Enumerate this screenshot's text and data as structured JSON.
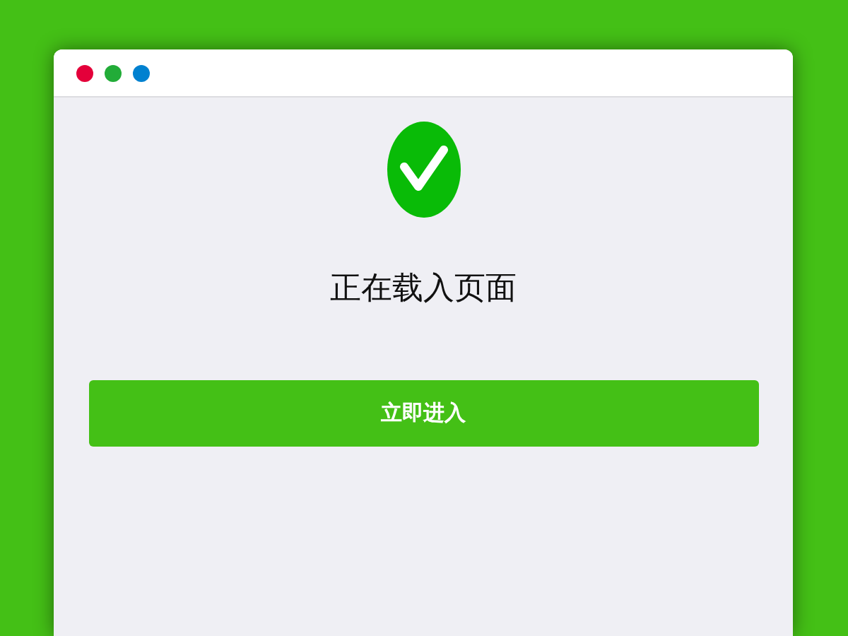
{
  "window": {
    "controls": [
      {
        "color": "#e4003a"
      },
      {
        "color": "#22ac38"
      },
      {
        "color": "#0081d0"
      }
    ]
  },
  "status": {
    "title": "正在载入页面"
  },
  "button": {
    "label": "立即进入"
  }
}
